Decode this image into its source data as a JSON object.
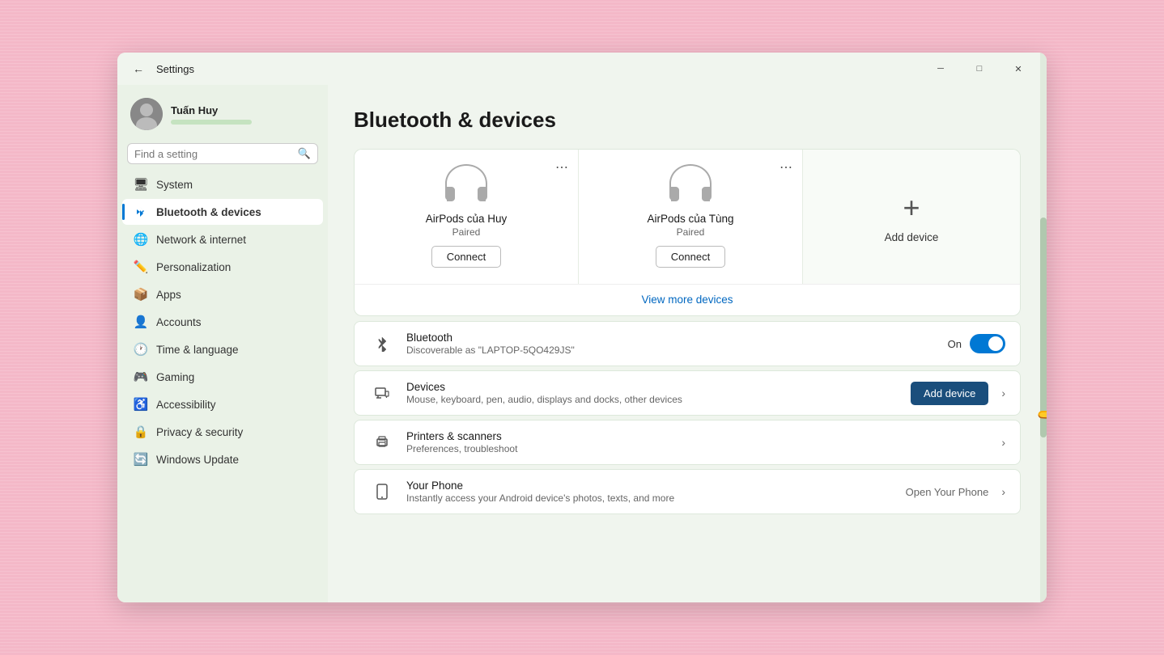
{
  "window": {
    "title": "Settings",
    "titlebar_back": "←",
    "controls": {
      "minimize": "─",
      "maximize": "□",
      "close": "✕"
    }
  },
  "sidebar": {
    "user": {
      "name": "Tuấn Huy"
    },
    "search": {
      "placeholder": "Find a setting"
    },
    "items": [
      {
        "id": "system",
        "label": "System",
        "icon": "🖥"
      },
      {
        "id": "bluetooth",
        "label": "Bluetooth & devices",
        "icon": "🔵",
        "active": true
      },
      {
        "id": "network",
        "label": "Network & internet",
        "icon": "🌐"
      },
      {
        "id": "personalization",
        "label": "Personalization",
        "icon": "✏"
      },
      {
        "id": "apps",
        "label": "Apps",
        "icon": "📦"
      },
      {
        "id": "accounts",
        "label": "Accounts",
        "icon": "👤"
      },
      {
        "id": "time",
        "label": "Time & language",
        "icon": "🕐"
      },
      {
        "id": "gaming",
        "label": "Gaming",
        "icon": "🎮"
      },
      {
        "id": "accessibility",
        "label": "Accessibility",
        "icon": "♿"
      },
      {
        "id": "privacy",
        "label": "Privacy & security",
        "icon": "🔒"
      },
      {
        "id": "update",
        "label": "Windows Update",
        "icon": "🔄"
      }
    ]
  },
  "main": {
    "page_title": "Bluetooth & devices",
    "device_cards": [
      {
        "name": "AirPods của Huy",
        "status": "Paired",
        "connect_label": "Connect"
      },
      {
        "name": "AirPods của Tùng",
        "status": "Paired",
        "connect_label": "Connect"
      },
      {
        "name": "Add device",
        "is_add": true
      }
    ],
    "view_more_label": "View more devices",
    "settings": [
      {
        "id": "bluetooth",
        "title": "Bluetooth",
        "sub": "Discoverable as \"LAPTOP-5QO429JS\"",
        "toggle": true,
        "toggle_label": "On"
      },
      {
        "id": "devices",
        "title": "Devices",
        "sub": "Mouse, keyboard, pen, audio, displays and docks, other devices",
        "add_btn": "Add device",
        "has_chevron": true
      },
      {
        "id": "printers",
        "title": "Printers & scanners",
        "sub": "Preferences, troubleshoot",
        "has_chevron": true
      },
      {
        "id": "phone",
        "title": "Your Phone",
        "sub": "Instantly access your Android device's photos, texts, and more",
        "action_label": "Open Your Phone",
        "has_chevron": true
      }
    ]
  }
}
